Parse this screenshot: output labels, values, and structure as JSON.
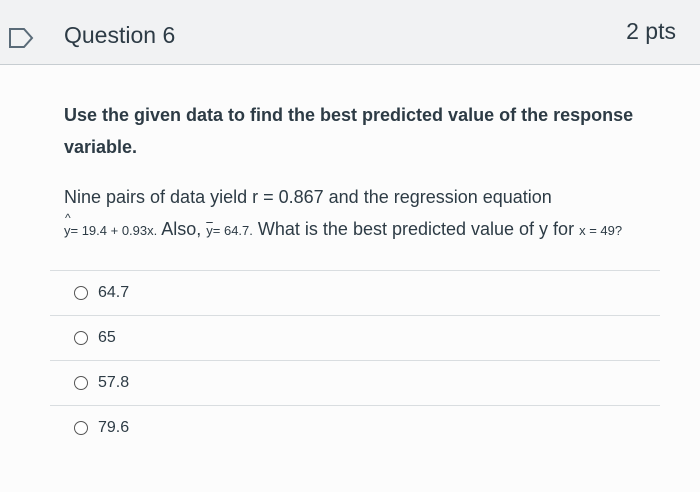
{
  "question": {
    "title": "Question 6",
    "points": "2 pts",
    "instruction": "Use the given data to find the best predicted value of the response variable.",
    "stem_line1": "Nine pairs of data yield r = 0.867 and the regression equation",
    "equation": "= 19.4 + 0.93x.",
    "also": " Also, ",
    "ybar_eq": "= 64.7.",
    "question_text": "What is the best predicted value of y for",
    "x_value": "x = 49?",
    "y_hat_symbol": "y",
    "y_bar_symbol": "y"
  },
  "answers": [
    {
      "label": "64.7"
    },
    {
      "label": "65"
    },
    {
      "label": "57.8"
    },
    {
      "label": "79.6"
    }
  ],
  "icons": {
    "flag": "flag-icon"
  }
}
